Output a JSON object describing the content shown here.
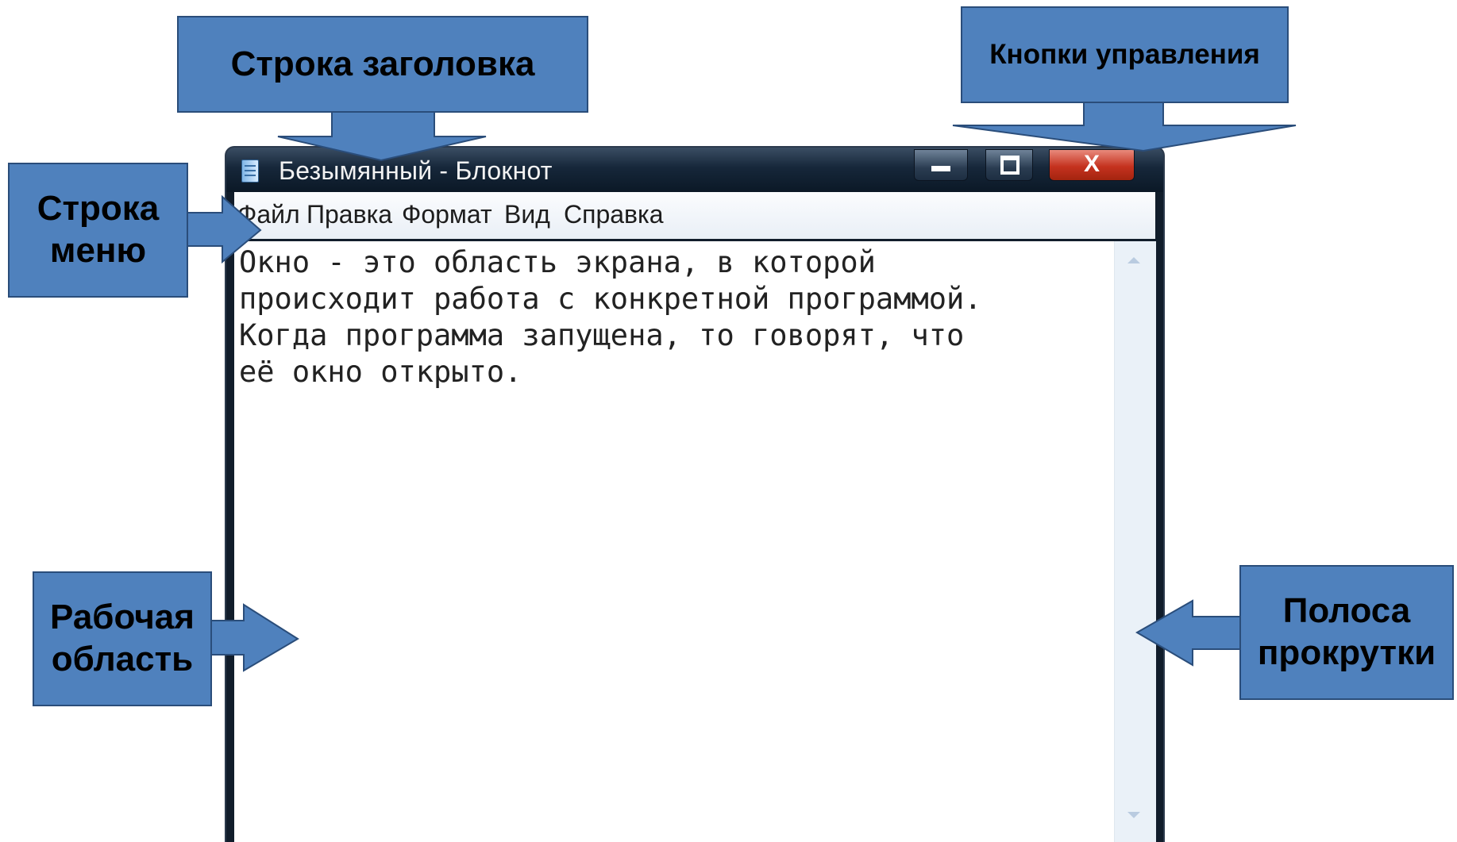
{
  "window": {
    "title": "Безымянный - Блокнот",
    "close_glyph": "X",
    "menu": [
      "Файл",
      "Правка",
      "Формат",
      "Вид",
      "Справка"
    ],
    "document_text": "Окно - это область экрана, в которой\nпроисходит работа с конкретной программой.\nКогда программа запущена, то говорят, что\nеё окно открыто."
  },
  "callouts": {
    "titlebar": "Строка заголовка",
    "controls": "Кнопки управления",
    "menubar": "Строка\nменю",
    "workarea": "Рабочая\nобласть",
    "scrollbar": "Полоса\nпрокрутки"
  },
  "colors": {
    "callout_fill": "#4f81bd",
    "callout_border": "#2a4d7a",
    "titlebar": "#16273a",
    "close_button": "#c5321f"
  },
  "icons": {
    "app": "notepad-icon",
    "minimize": "minimize-icon",
    "maximize": "maximize-icon",
    "close": "close-icon",
    "scroll_up": "scroll-up-arrow-icon",
    "scroll_down": "scroll-down-arrow-icon"
  }
}
